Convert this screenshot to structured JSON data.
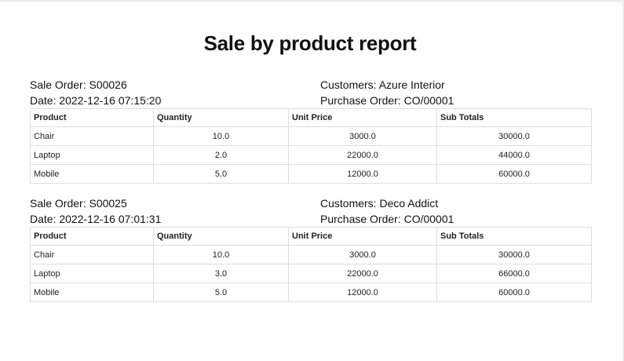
{
  "report": {
    "title": "Sale by product report"
  },
  "columns": [
    "Product",
    "Quantity",
    "Unit Price",
    "Sub Totals"
  ],
  "orders": [
    {
      "sale_order": "Sale Order: S00026",
      "date": "Date: 2022-12-16 07:15:20",
      "customer": "Customers: Azure Interior",
      "purchase_order": "Purchase Order: CO/00001",
      "rows": [
        {
          "product": "Chair",
          "quantity": "10.0",
          "unit_price": "3000.0",
          "sub_total": "30000.0"
        },
        {
          "product": "Laptop",
          "quantity": "2.0",
          "unit_price": "22000.0",
          "sub_total": "44000.0"
        },
        {
          "product": "Mobile",
          "quantity": "5.0",
          "unit_price": "12000.0",
          "sub_total": "60000.0"
        }
      ]
    },
    {
      "sale_order": "Sale Order: S00025",
      "date": "Date: 2022-12-16 07:01:31",
      "customer": "Customers: Deco Addict",
      "purchase_order": "Purchase Order: CO/00001",
      "rows": [
        {
          "product": "Chair",
          "quantity": "10.0",
          "unit_price": "3000.0",
          "sub_total": "30000.0"
        },
        {
          "product": "Laptop",
          "quantity": "3.0",
          "unit_price": "22000.0",
          "sub_total": "66000.0"
        },
        {
          "product": "Mobile",
          "quantity": "5.0",
          "unit_price": "12000.0",
          "sub_total": "60000.0"
        }
      ]
    }
  ]
}
